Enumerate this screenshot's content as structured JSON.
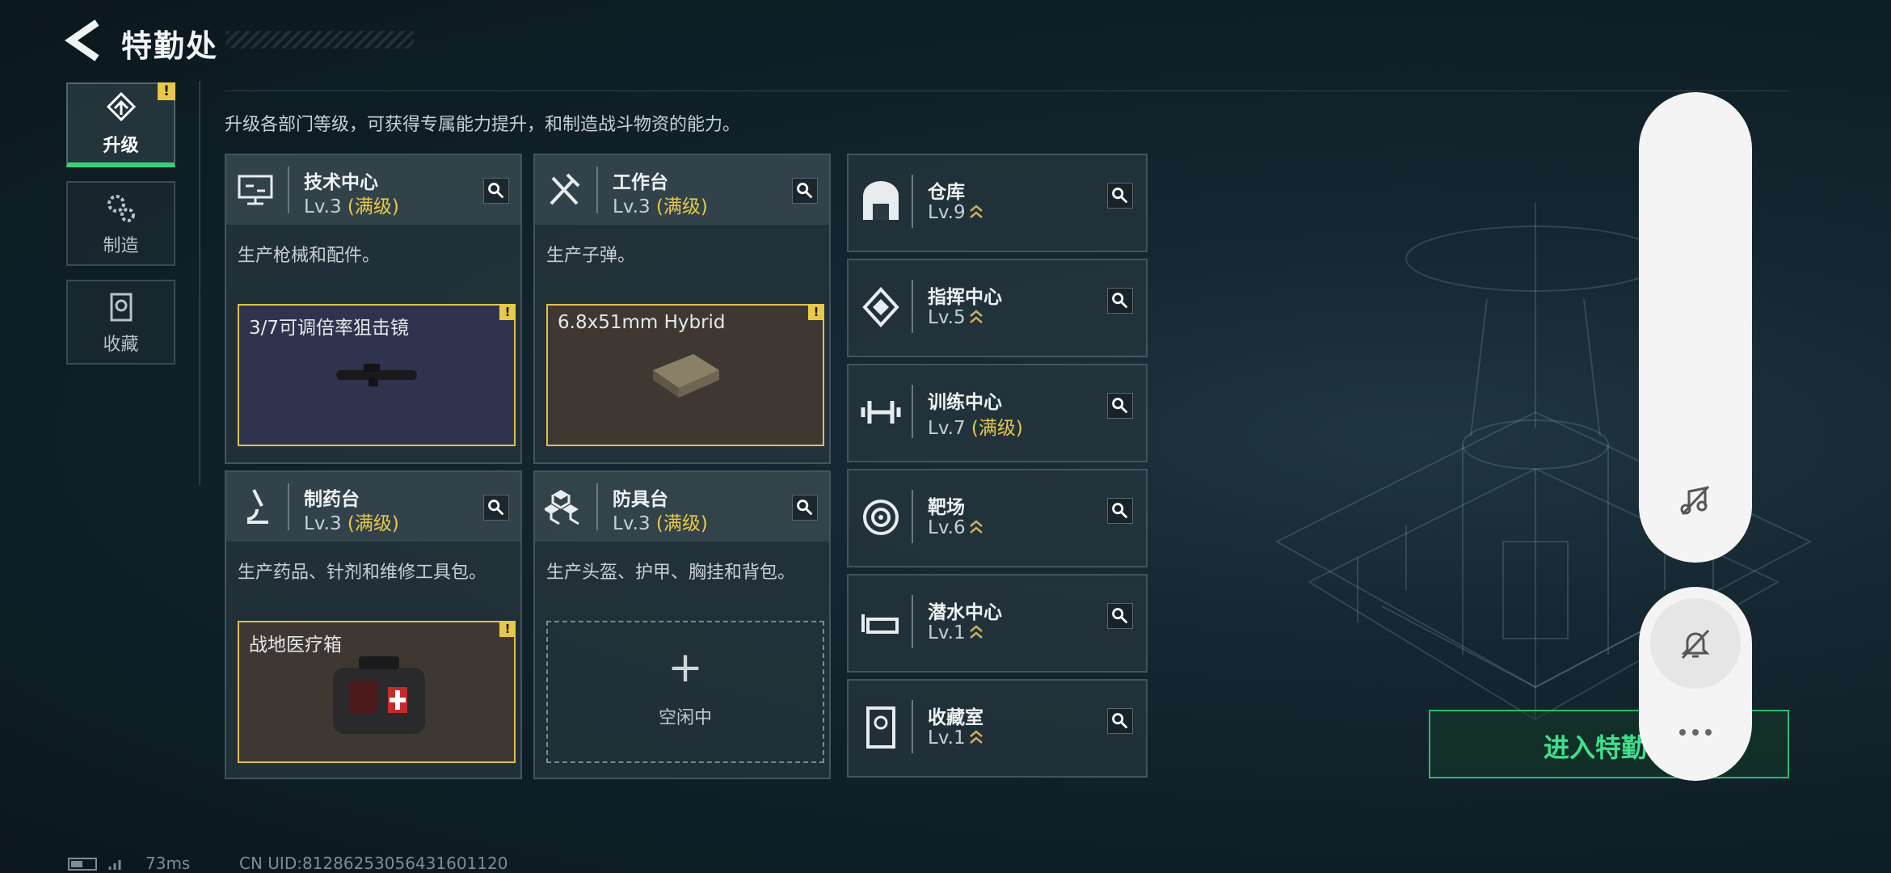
{
  "header": {
    "title": "特勤处",
    "back_icon": "back-arrow-icon"
  },
  "tabs": [
    {
      "label": "升级",
      "icon": "upgrade-icon",
      "active": true,
      "badge": "!"
    },
    {
      "label": "制造",
      "icon": "gears-icon",
      "active": false
    },
    {
      "label": "收藏",
      "icon": "collection-icon",
      "active": false
    }
  ],
  "description": "升级各部门等级，可获得专属能力提升，和制造战斗物资的能力。",
  "cards": [
    {
      "name": "技术中心",
      "level": "Lv.3",
      "max_label": "(满级)",
      "desc": "生产枪械和配件。",
      "slot": {
        "item": "3/7可调倍率狙击镜",
        "badge": "!"
      }
    },
    {
      "name": "工作台",
      "level": "Lv.3",
      "max_label": "(满级)",
      "desc": "生产子弹。",
      "slot": {
        "item": "6.8x51mm Hybrid",
        "badge": "!"
      }
    },
    {
      "name": "制药台",
      "level": "Lv.3",
      "max_label": "(满级)",
      "desc": "生产药品、针剂和维修工具包。",
      "slot": {
        "item": "战地医疗箱",
        "badge": "!"
      }
    },
    {
      "name": "防具台",
      "level": "Lv.3",
      "max_label": "(满级)",
      "desc": "生产头盔、护甲、胸挂和背包。",
      "slot": {
        "idle_plus": "+",
        "idle_label": "空闲中"
      }
    }
  ],
  "facilities": [
    {
      "name": "仓库",
      "level": "Lv.9"
    },
    {
      "name": "指挥中心",
      "level": "Lv.5"
    },
    {
      "name": "训练中心",
      "level": "Lv.7",
      "max_label": "(满级)"
    },
    {
      "name": "靶场",
      "level": "Lv.6"
    },
    {
      "name": "潜水中心",
      "level": "Lv.1"
    },
    {
      "name": "收藏室",
      "level": "Lv.1"
    }
  ],
  "enter_button": "进入特勤",
  "status": {
    "ping": "73ms",
    "uid": "CN UID:81286253056431601120"
  },
  "colors": {
    "accent_green": "#38d07c",
    "max_yellow": "#e8c84a"
  }
}
